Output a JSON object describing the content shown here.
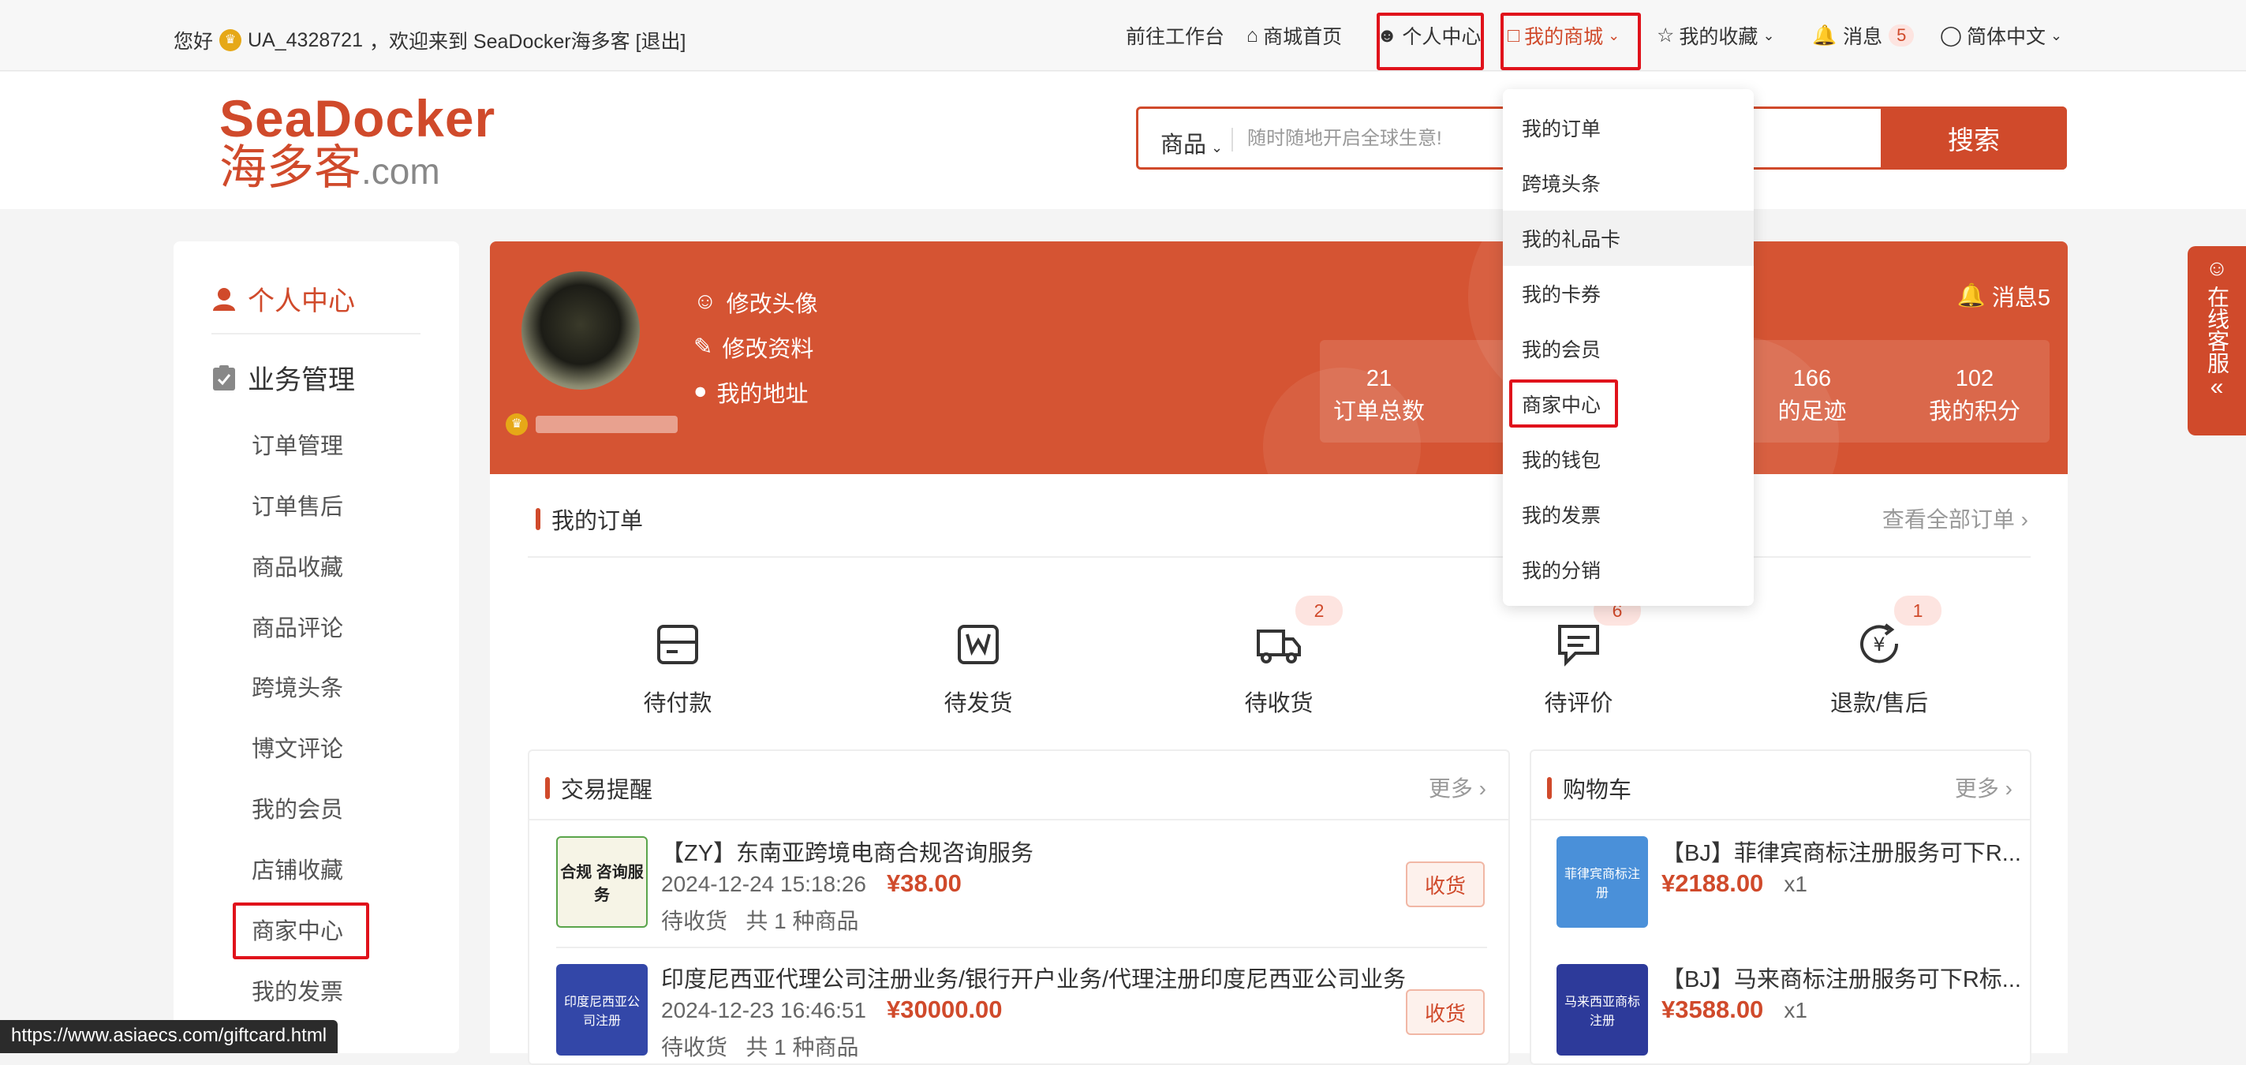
{
  "topbar": {
    "greeting_prefix": "您好",
    "username": "UA_4328721",
    "greeting_suffix": "，欢迎来到 SeaDocker海多客 [退出]",
    "workbench": "前往工作台",
    "home": "商城首页",
    "personal_center": "个人中心",
    "my_mall": "我的商城",
    "favorites": "我的收藏",
    "messages": "消息",
    "message_count": "5",
    "language": "简体中文"
  },
  "logo": {
    "line1": "SeaDocker",
    "line2": "海多客",
    "line2_suffix": ".com"
  },
  "search": {
    "category": "商品",
    "placeholder": "随时随地开启全球生意!",
    "button": "搜索"
  },
  "sidebar": {
    "personal": "个人中心",
    "business": "业务管理",
    "items": [
      "订单管理",
      "订单售后",
      "商品收藏",
      "商品评论",
      "跨境头条",
      "博文评论",
      "我的会员",
      "店铺收藏",
      "商家中心",
      "我的发票"
    ]
  },
  "banner": {
    "links": [
      "修改头像",
      "修改资料",
      "我的地址"
    ],
    "messages": "消息5",
    "stats": [
      {
        "value": "21",
        "label": "订单总数"
      },
      {
        "value": "166",
        "label": "的足迹"
      },
      {
        "value": "102",
        "label": "我的积分"
      }
    ]
  },
  "orders": {
    "title": "我的订单",
    "view_all": "查看全部订单",
    "statuses": [
      {
        "label": "待付款",
        "badge": ""
      },
      {
        "label": "待发货",
        "badge": ""
      },
      {
        "label": "待收货",
        "badge": "2"
      },
      {
        "label": "待评价",
        "badge": "6"
      },
      {
        "label": "退款/售后",
        "badge": "1"
      }
    ]
  },
  "trade": {
    "title": "交易提醒",
    "more": "更多",
    "thumb1_text": "合规 咨询服务",
    "thumb2_text": "印度尼西亚公司注册",
    "items": [
      {
        "title": "【ZY】东南亚跨境电商合规咨询服务",
        "date": "2024-12-24 15:18:26",
        "price": "¥38.00",
        "status": "待收货",
        "count": "共 1 种商品",
        "button": "收货"
      },
      {
        "title": "印度尼西亚代理公司注册业务/银行开户业务/代理注册印度尼西亚公司业务",
        "date": "2024-12-23 16:46:51",
        "price": "¥30000.00",
        "status": "待收货",
        "count": "共 1 种商品",
        "button": "收货"
      }
    ]
  },
  "cart": {
    "title": "购物车",
    "more": "更多",
    "thumb1_text": "菲律宾商标注册",
    "thumb2_text": "马来西亚商标注册",
    "items": [
      {
        "title": "【BJ】菲律宾商标注册服务可下R...",
        "price": "¥2188.00",
        "qty": "x1"
      },
      {
        "title": "【BJ】马来商标注册服务可下R标...",
        "price": "¥3588.00",
        "qty": "x1"
      }
    ]
  },
  "dropdown": {
    "items": [
      "我的订单",
      "跨境头条",
      "我的礼品卡",
      "我的卡券",
      "我的会员",
      "商家中心",
      "我的钱包",
      "我的发票",
      "我的分销"
    ]
  },
  "service": {
    "label": "在线客服"
  },
  "statusbar": {
    "url": "https://www.asiaecs.com/giftcard.html"
  },
  "colors": {
    "accent": "#d04a2b",
    "highlight_box": "#e0121b"
  }
}
